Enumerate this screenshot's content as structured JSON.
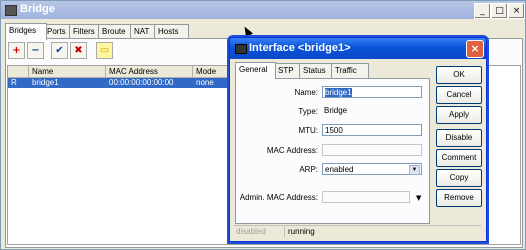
{
  "window": {
    "title": "Bridge",
    "controls": {
      "minimize": "_",
      "maximize": "□",
      "close": "×"
    }
  },
  "tabs": [
    "Bridges",
    "Ports",
    "Filters",
    "Broute",
    "NAT",
    "Hosts"
  ],
  "toolbar": {
    "add": "+",
    "remove": "−",
    "enable": "✔",
    "disable": "✖",
    "comment": "▭"
  },
  "table": {
    "headers": [
      "",
      "Name",
      "MAC Address",
      "Mode"
    ],
    "rows": [
      {
        "flag": "R",
        "name": "bridge1",
        "mac": "00:00:00:00:00:00",
        "mode": "none"
      }
    ]
  },
  "dialog": {
    "title": "Interface <bridge1>",
    "close": "×",
    "tabs": [
      "General",
      "STP",
      "Status",
      "Traffic"
    ],
    "fields": {
      "name_label": "Name:",
      "name_value": "bridge1",
      "type_label": "Type:",
      "type_value": "Bridge",
      "mtu_label": "MTU:",
      "mtu_value": "1500",
      "mac_label": "MAC Address:",
      "mac_value": "",
      "arp_label": "ARP:",
      "arp_value": "enabled",
      "admin_mac_label": "Admin. MAC Address:",
      "admin_mac_value": ""
    },
    "buttons": [
      "OK",
      "Cancel",
      "Apply",
      "Disable",
      "Comment",
      "Copy",
      "Remove"
    ],
    "status": {
      "left": "disabled",
      "right": "running"
    }
  },
  "colors": {
    "titlebar_active": "#0a53d8",
    "selection": "#3169c6",
    "add_red": "#cc0000",
    "check_blue": "#1040c0"
  }
}
